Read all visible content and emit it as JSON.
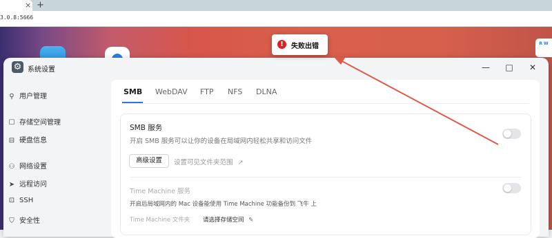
{
  "browser": {
    "url_fragment": "3.0.8:5666",
    "tab_close": "×",
    "new_tab": "+"
  },
  "desktop": {
    "widget_text": "R W"
  },
  "window": {
    "title": "系统设置",
    "controls": {
      "minimize": "—",
      "maximize": "□",
      "close": "✕"
    }
  },
  "sidebar": {
    "items": [
      {
        "label": "用户管理",
        "icon": "users-icon",
        "glyph": "⚲"
      },
      {
        "label": "存储空间管理",
        "icon": "storage-icon",
        "glyph": "☐"
      },
      {
        "label": "硬盘信息",
        "icon": "disk-icon",
        "glyph": "⊟"
      },
      {
        "label": "网络设置",
        "icon": "network-icon",
        "glyph": "⚇"
      },
      {
        "label": "远程访问",
        "icon": "send-icon",
        "glyph": "➤"
      },
      {
        "label": "SSH",
        "icon": "terminal-icon",
        "glyph": "⊡"
      },
      {
        "label": "安全性",
        "icon": "shield-icon",
        "glyph": "⛉"
      }
    ]
  },
  "tabs": [
    "SMB",
    "WebDAV",
    "FTP",
    "NFS",
    "DLNA"
  ],
  "smb": {
    "title": "SMB 服务",
    "desc": "开启 SMB 服务可以让你的设备在局域网内轻松共享和访问文件",
    "advanced_button": "高级设置",
    "visible_range_link": "设置可见文件夹范围",
    "link_icon": "↗"
  },
  "time_machine": {
    "title": "Time Machine 服务",
    "desc": "开启后局域网内的 Mac 设备能使用 Time Machine 功能备份到 飞牛 上",
    "folder_label": "Time Machine 文件夹",
    "folder_value": "请选择存储空间",
    "edit_icon": "✎"
  },
  "toast": {
    "text": "失败出错",
    "icon": "!"
  },
  "colors": {
    "accent": "#2d74e6",
    "error": "#e02020",
    "annotation_arrow": "#e0584a"
  }
}
